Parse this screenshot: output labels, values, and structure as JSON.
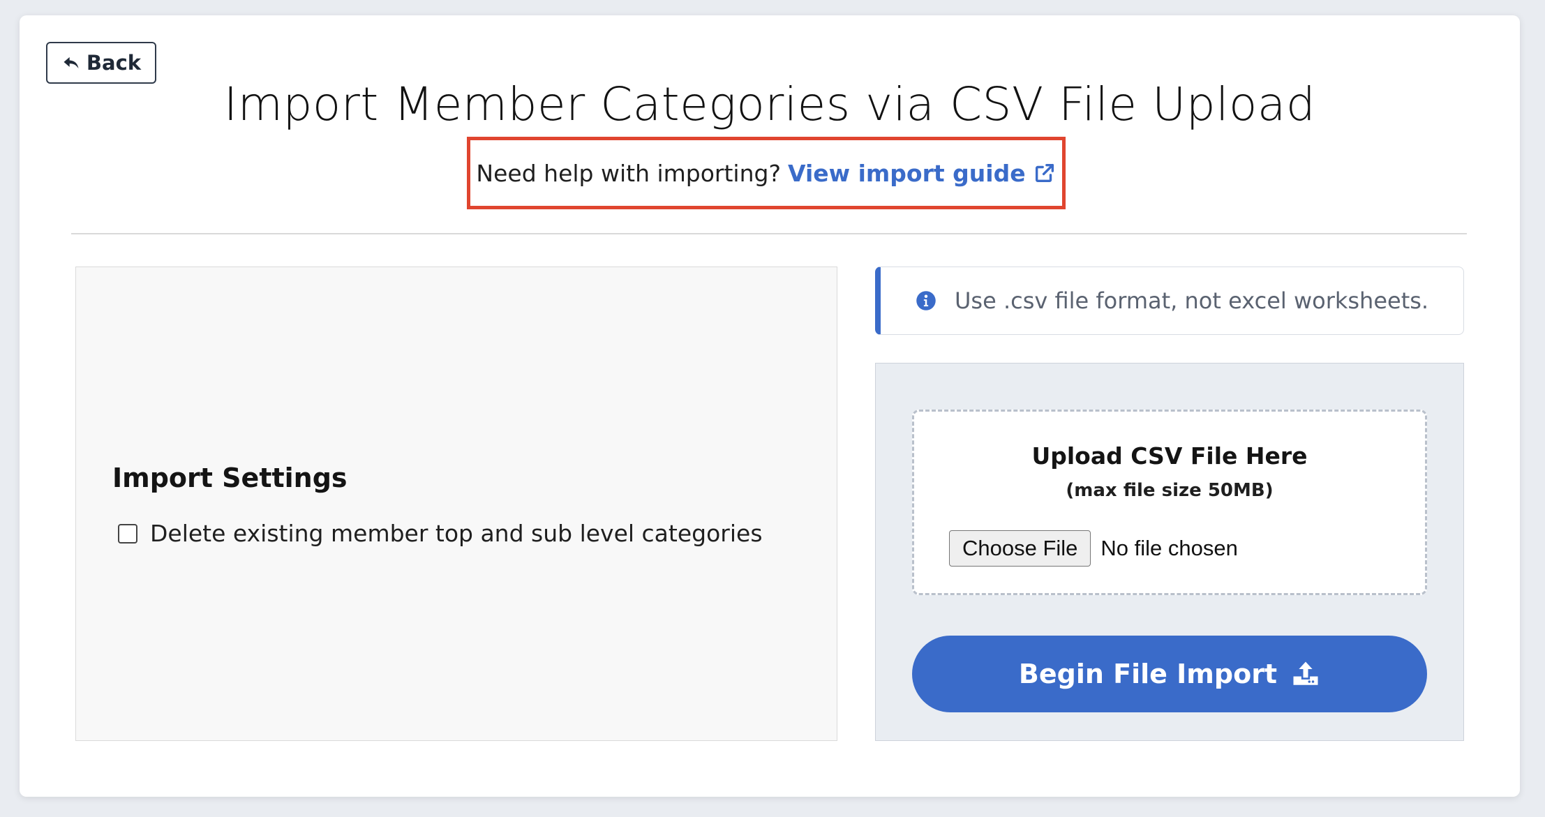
{
  "header": {
    "back_label": "Back",
    "title": "Import Member Categories via CSV File Upload",
    "help_text": "Need help with importing?",
    "help_link_label": "View import guide"
  },
  "settings": {
    "title": "Import Settings",
    "checkbox_label": "Delete existing member top and sub level categories",
    "checkbox_checked": false
  },
  "info_alert": {
    "text": "Use .csv file format, not excel worksheets."
  },
  "upload": {
    "title": "Upload CSV File Here",
    "subtitle": "(max file size 50MB)",
    "choose_file_label": "Choose File",
    "file_status": "No file chosen",
    "begin_import_label": "Begin File Import"
  },
  "colors": {
    "accent": "#3a6bc9",
    "highlight_border": "#e0452f"
  },
  "icons": {
    "back": "reply-arrow-icon",
    "help_link": "external-link-icon",
    "info": "info-circle-icon",
    "import": "upload-tray-icon"
  }
}
